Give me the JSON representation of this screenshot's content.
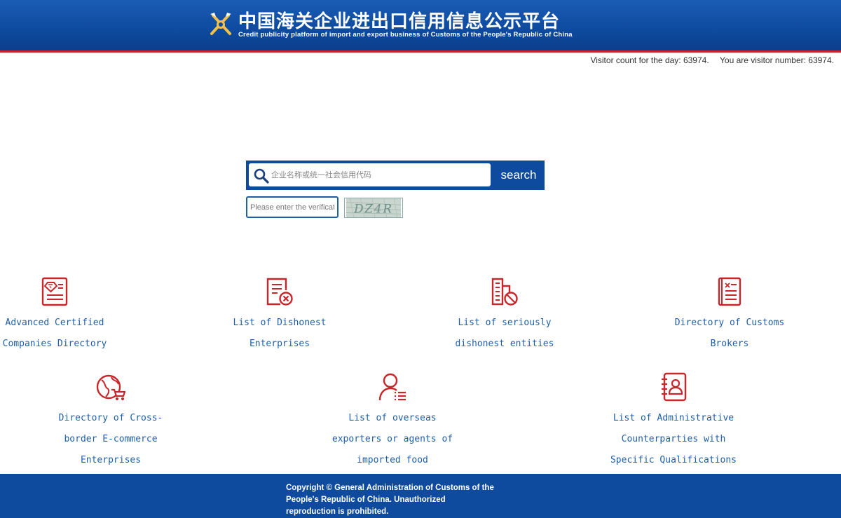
{
  "header": {
    "title_cn": "中国海关企业进出口信用信息公示平台",
    "title_en": "Credit publicity platform of import and export business of Customs of the People's Republic of China",
    "logo_icon": "customs-emblem-icon"
  },
  "visitor": {
    "today": "Visitor count for the day: 63974.",
    "you": "You are visitor number: 63974."
  },
  "search": {
    "placeholder": "企业名称或统一社会信用代码",
    "button_label": "search",
    "verify_placeholder": "Please enter the verification code",
    "captcha_text": "DZ4R"
  },
  "categories": [
    {
      "line1": "Advanced Certified",
      "line2": "Companies Directory",
      "line3": "",
      "icon": "certificate-icon"
    },
    {
      "line1": "List of Dishonest",
      "line2": "Enterprises",
      "line3": "",
      "icon": "document-x-icon"
    },
    {
      "line1": "List of seriously",
      "line2": "dishonest entities",
      "line3": "",
      "icon": "building-ban-icon"
    },
    {
      "line1": "Directory of Customs",
      "line2": "Brokers",
      "line3": "",
      "icon": "notebook-icon"
    },
    {
      "line1": "Directory of Cross-",
      "line2": "border E-commerce",
      "line3": "Enterprises",
      "icon": "globe-cart-icon"
    },
    {
      "line1": "List of overseas",
      "line2": "exporters or agents of",
      "line3": "imported food",
      "icon": "person-list-icon"
    },
    {
      "line1": "List of Administrative",
      "line2": "Counterparties with",
      "line3": "Specific Qualifications",
      "icon": "contact-book-icon"
    }
  ],
  "footer": {
    "copyright": "Copyright © General Administration of Customs of the People's Republic of China. Unauthorized reproduction is prohibited."
  },
  "colors": {
    "header_blue": "#0e4a9e",
    "accent_red": "#c8262a",
    "link_blue": "#1f5fa8"
  }
}
